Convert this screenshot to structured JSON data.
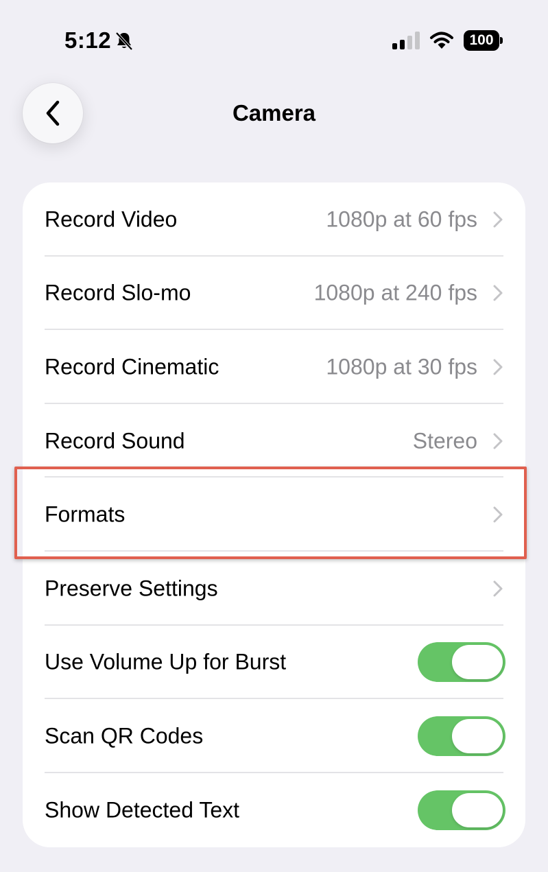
{
  "status_bar": {
    "time": "5:12",
    "battery": "100"
  },
  "nav": {
    "title": "Camera"
  },
  "rows": [
    {
      "label": "Record Video",
      "value": "1080p at 60 fps"
    },
    {
      "label": "Record Slo-mo",
      "value": "1080p at 240 fps"
    },
    {
      "label": "Record Cinematic",
      "value": "1080p at 30 fps"
    },
    {
      "label": "Record Sound",
      "value": "Stereo"
    },
    {
      "label": "Formats",
      "value": ""
    },
    {
      "label": "Preserve Settings",
      "value": ""
    },
    {
      "label": "Use Volume Up for Burst",
      "toggle": true
    },
    {
      "label": "Scan QR Codes",
      "toggle": true
    },
    {
      "label": "Show Detected Text",
      "toggle": true
    }
  ],
  "colors": {
    "toggle_on": "#65c466",
    "highlight": "#e0604f",
    "background": "#f0eff5"
  }
}
